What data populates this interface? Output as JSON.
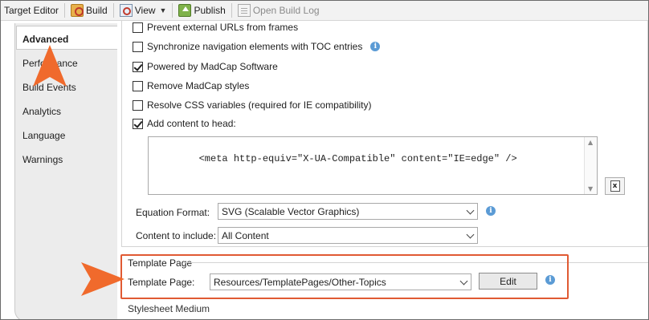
{
  "toolbar": {
    "target_editor": "Target Editor",
    "build": "Build",
    "view": "View",
    "publish": "Publish",
    "open_build_log": "Open Build Log"
  },
  "sidebar": {
    "items": [
      {
        "label": "Advanced",
        "active": true
      },
      {
        "label": "Performance"
      },
      {
        "label": "Build Events"
      },
      {
        "label": "Analytics"
      },
      {
        "label": "Language"
      },
      {
        "label": "Warnings"
      }
    ]
  },
  "options": {
    "prevent_external": {
      "label": "Prevent external URLs from frames",
      "checked": false
    },
    "sync_nav": {
      "label": "Synchronize navigation elements with TOC entries",
      "checked": false
    },
    "powered_by": {
      "label": "Powered by MadCap Software",
      "checked": true
    },
    "remove_styles": {
      "label": "Remove MadCap styles",
      "checked": false
    },
    "resolve_css": {
      "label": "Resolve CSS variables (required for IE compatibility)",
      "checked": false
    },
    "add_head": {
      "label": "Add content to head:",
      "checked": true
    }
  },
  "head_content": "<meta http-equiv=\"X-UA-Compatible\" content=\"IE=edge\" />",
  "equation": {
    "label": "Equation Format:",
    "value": "SVG (Scalable Vector Graphics)"
  },
  "content_include": {
    "label": "Content to include:",
    "value": "All Content"
  },
  "template": {
    "group_title": "Template Page",
    "label": "Template Page:",
    "value": "Resources/TemplatePages/Other-Topics",
    "edit": "Edit"
  },
  "next_section": "Stylesheet Medium",
  "colors": {
    "callout": "#f06a2c",
    "highlight_border": "#e05a33",
    "info": "#5b9bd5"
  }
}
